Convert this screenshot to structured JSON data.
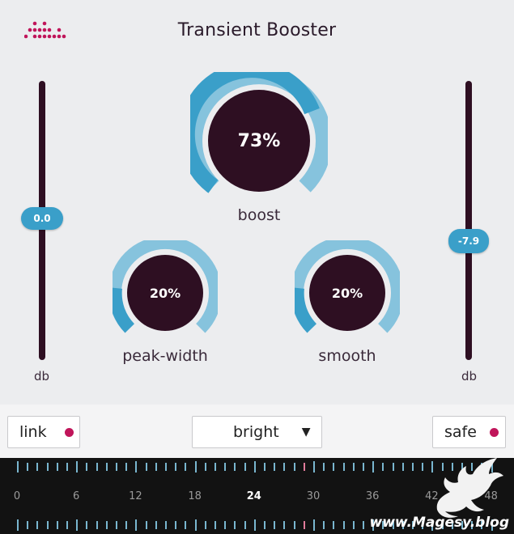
{
  "header": {
    "title": "Transient Booster",
    "logo_icon": "dotted-logo-icon"
  },
  "sliders": {
    "left": {
      "value_label": "0.0",
      "unit": "db",
      "level": 0.5
    },
    "right": {
      "value_label": "-7.9",
      "unit": "db",
      "level": 0.57
    }
  },
  "knobs": {
    "boost": {
      "value_label": "73%",
      "label": "boost",
      "value": 0.73
    },
    "peak_width": {
      "value_label": "20%",
      "label": "peak-width",
      "value": 0.2
    },
    "smooth": {
      "value_label": "20%",
      "label": "smooth",
      "value": 0.2
    }
  },
  "controls": {
    "link": {
      "label": "link"
    },
    "mode": {
      "selected": "bright",
      "arrow": "▼"
    },
    "safe": {
      "label": "safe"
    }
  },
  "ruler": {
    "labels": [
      "0",
      "6",
      "12",
      "18",
      "24",
      "30",
      "36",
      "42",
      "48"
    ],
    "bold_label": "24"
  },
  "watermark": {
    "text": "www.Magesy.blog"
  },
  "colors": {
    "accent": "#3a9fc9",
    "knob_body": "#2e0f22",
    "indicator": "#c0155a"
  }
}
